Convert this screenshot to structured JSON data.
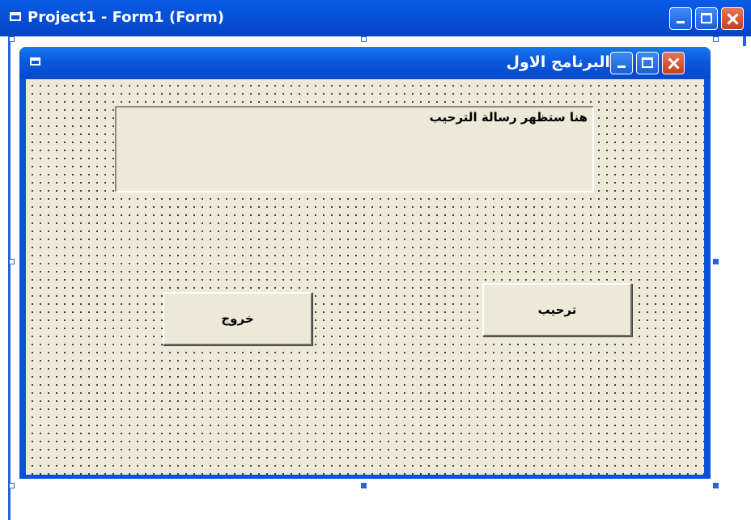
{
  "designer": {
    "title": "Project1 - Form1 (Form)"
  },
  "form": {
    "caption": "البرنامج الاول",
    "label_text": "هنا ستظهر رسالة الترحيب",
    "buttons": {
      "exit": "خروج",
      "welcome": "ترحيب"
    }
  },
  "colors": {
    "titlebar": "#0750d8",
    "form_background": "#ece9d8",
    "close_button": "#c2401e"
  }
}
